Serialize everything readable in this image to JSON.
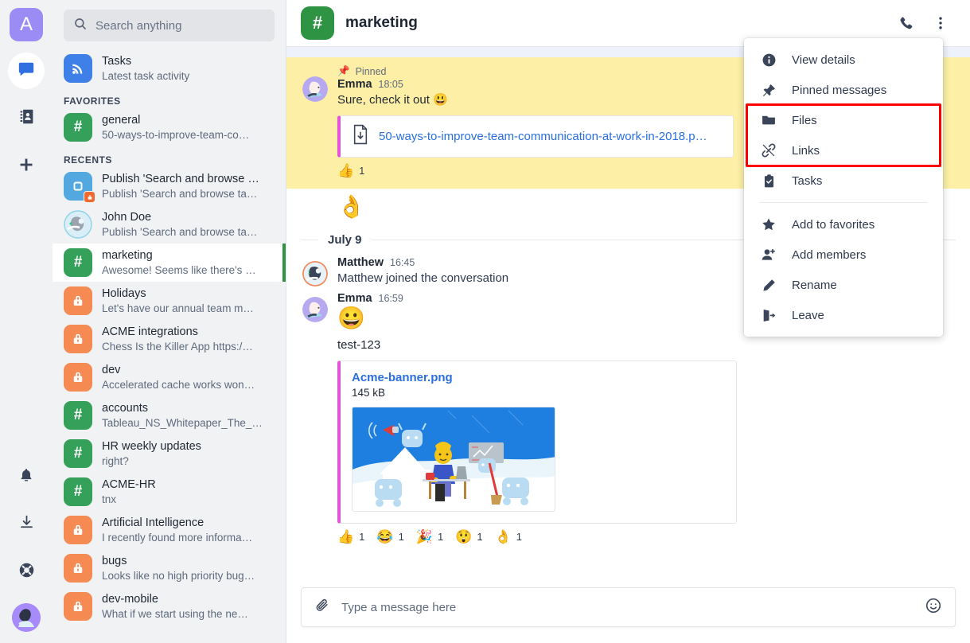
{
  "rail": {
    "logo_initial": "A",
    "items": [
      {
        "name": "chat-icon",
        "label": "Chat"
      },
      {
        "name": "contacts-icon",
        "label": "Contacts"
      },
      {
        "name": "add-icon",
        "label": "Add"
      },
      {
        "name": "bell-icon",
        "label": "Notifications"
      },
      {
        "name": "download-icon",
        "label": "Downloads"
      },
      {
        "name": "help-icon",
        "label": "Help"
      }
    ]
  },
  "search": {
    "placeholder": "Search anything",
    "value": "",
    "icon": "search-icon"
  },
  "sidebar": {
    "pinned_item": {
      "title": "Tasks",
      "subtitle": "Latest task activity",
      "icon": "feed-icon"
    },
    "sections": [
      {
        "label": "FAVORITES",
        "items": [
          {
            "title": "general",
            "subtitle": "50-ways-to-improve-team-co…",
            "type": "hash"
          }
        ]
      },
      {
        "label": "RECENTS",
        "items": [
          {
            "title": "Publish 'Search and browse …",
            "subtitle": "Publish 'Search and browse ta…",
            "type": "board"
          },
          {
            "title": "John Doe",
            "subtitle": "Publish 'Search and browse ta…",
            "type": "person"
          },
          {
            "title": "marketing",
            "subtitle": "Awesome! Seems like there's …",
            "type": "hash",
            "selected": true
          },
          {
            "title": "Holidays",
            "subtitle": "Let's have our annual team m…",
            "type": "lock"
          },
          {
            "title": "ACME integrations",
            "subtitle": "Chess Is the Killer App https:/…",
            "type": "lock"
          },
          {
            "title": "dev",
            "subtitle": "Accelerated cache works won…",
            "type": "lock"
          },
          {
            "title": "accounts",
            "subtitle": "Tableau_NS_Whitepaper_The_…",
            "type": "hash"
          },
          {
            "title": "HR weekly updates",
            "subtitle": "right?",
            "type": "hash"
          },
          {
            "title": "ACME-HR",
            "subtitle": "tnx",
            "type": "hash"
          },
          {
            "title": "Artificial Intelligence",
            "subtitle": "I recently found more informa…",
            "type": "lock"
          },
          {
            "title": "bugs",
            "subtitle": "Looks like no high priority bug…",
            "type": "lock"
          },
          {
            "title": "dev-mobile",
            "subtitle": "What if we start using the ne…",
            "type": "lock"
          }
        ]
      }
    ]
  },
  "header": {
    "channel_symbol": "#",
    "title": "marketing",
    "call_icon": "phone-icon",
    "more_icon": "more-vertical-icon"
  },
  "menu": {
    "items": [
      {
        "label": "View details",
        "icon": "info-icon"
      },
      {
        "label": "Pinned messages",
        "icon": "pin-icon"
      },
      {
        "label": "Files",
        "icon": "folder-icon",
        "highlighted": true
      },
      {
        "label": "Links",
        "icon": "link-icon",
        "highlighted": true
      },
      {
        "label": "Tasks",
        "icon": "clipboard-check-icon"
      },
      {
        "label": "Add to favorites",
        "icon": "star-icon",
        "after_separator": true
      },
      {
        "label": "Add members",
        "icon": "add-person-icon"
      },
      {
        "label": "Rename",
        "icon": "pencil-icon"
      },
      {
        "label": "Leave",
        "icon": "exit-icon"
      }
    ],
    "highlight_color": "#ff0000"
  },
  "conversation": {
    "pinned_message": {
      "pin_label": "Pinned",
      "author": "Emma",
      "time": "18:05",
      "text": "Sure, check it out 😃",
      "file": {
        "name": "50-ways-to-improve-team-communication-at-work-in-2018.p…",
        "icon": "file-download-icon"
      },
      "reactions": [
        {
          "emoji": "👍",
          "count": "1"
        }
      ]
    },
    "standalone_emoji": "👌",
    "day_separator": "July 9",
    "messages": [
      {
        "author": "Matthew",
        "time": "16:45",
        "text": "Matthew joined the conversation",
        "avatar": "matthew-avatar"
      },
      {
        "author": "Emma",
        "time": "16:59",
        "emoji": "😀",
        "text": "test-123",
        "avatar": "emma-avatar",
        "attachment": {
          "name": "Acme-banner.png",
          "size": "145 kB"
        },
        "reactions": [
          {
            "emoji": "👍",
            "count": "1"
          },
          {
            "emoji": "😂",
            "count": "1"
          },
          {
            "emoji": "🎉",
            "count": "1"
          },
          {
            "emoji": "😲",
            "count": "1"
          },
          {
            "emoji": "👌",
            "count": "1"
          }
        ]
      }
    ]
  },
  "composer": {
    "placeholder": "Type a message here",
    "value": "",
    "attach_icon": "paperclip-icon",
    "emoji_icon": "emoji-icon"
  },
  "colors": {
    "brand_green": "#2e9444",
    "accent_purple": "#9b8cf5",
    "pinned_yellow": "#fdf0a6",
    "link_blue": "#2a6fe0",
    "lock_orange": "#f58b53",
    "highlight_red": "#ff0000"
  }
}
